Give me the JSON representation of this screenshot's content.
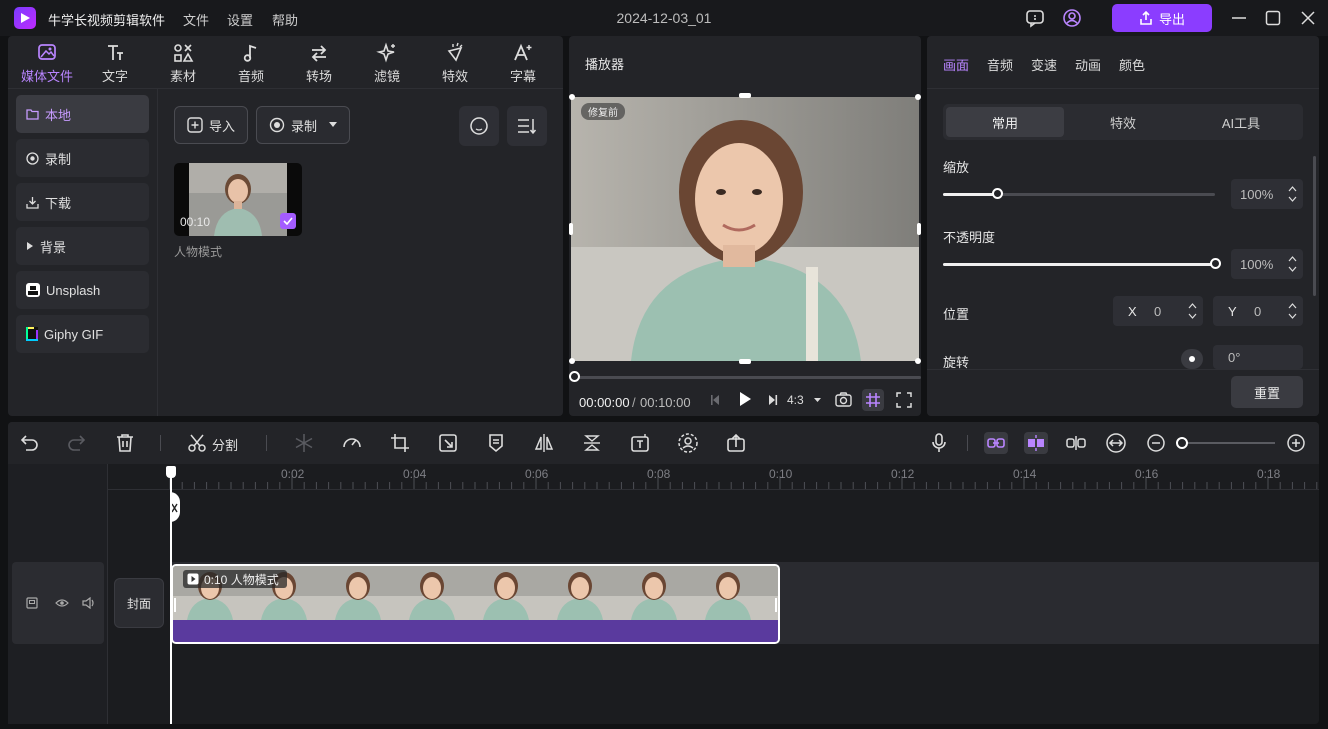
{
  "app": {
    "title": "牛学长视频剪辑软件",
    "menu": [
      "文件",
      "设置",
      "帮助"
    ],
    "project_name": "2024-12-03_01",
    "export_label": "导出"
  },
  "media_panel": {
    "tabs": [
      {
        "label": "媒体文件",
        "icon": "media-icon"
      },
      {
        "label": "文字",
        "icon": "text-icon"
      },
      {
        "label": "素材",
        "icon": "elements-icon"
      },
      {
        "label": "音频",
        "icon": "music-icon"
      },
      {
        "label": "转场",
        "icon": "transition-icon"
      },
      {
        "label": "滤镜",
        "icon": "filter-icon"
      },
      {
        "label": "特效",
        "icon": "effects-icon"
      },
      {
        "label": "字幕",
        "icon": "subtitle-icon"
      }
    ],
    "sidebar": [
      {
        "label": "本地",
        "icon": "folder-icon"
      },
      {
        "label": "录制",
        "icon": "record-icon"
      },
      {
        "label": "下载",
        "icon": "download-icon"
      },
      {
        "label": "背景",
        "icon": "caret-right-icon"
      },
      {
        "label": "Unsplash",
        "icon": "unsplash-icon"
      },
      {
        "label": "Giphy GIF",
        "icon": "giphy-icon"
      }
    ],
    "import_label": "导入",
    "record_label": "录制",
    "clip": {
      "duration": "00:10",
      "name": "人物模式"
    }
  },
  "player": {
    "title": "播放器",
    "badge": "修复前",
    "time_current": "00:00:00",
    "time_separator": "/",
    "time_total": "00:10:00",
    "aspect_ratio": "4:3"
  },
  "properties": {
    "tabs": [
      "画面",
      "音频",
      "变速",
      "动画",
      "颜色"
    ],
    "segments": [
      "常用",
      "特效",
      "AI工具"
    ],
    "scale": {
      "label": "缩放",
      "value": "100%",
      "fraction": 0.2
    },
    "opacity": {
      "label": "不透明度",
      "value": "100%",
      "fraction": 1.0
    },
    "position": {
      "label": "位置",
      "x_label": "X",
      "x_value": "0",
      "y_label": "Y",
      "y_value": "0"
    },
    "rotation": {
      "label": "旋转",
      "value": "0°"
    },
    "reset_label": "重置"
  },
  "timeline": {
    "split_label": "分割",
    "ruler": [
      "0:02",
      "0:04",
      "0:06",
      "0:08",
      "0:10",
      "0:12",
      "0:14",
      "0:16",
      "0:18"
    ],
    "cover_label": "封面",
    "clip_label": "0:10 人物模式"
  },
  "colors": {
    "accent": "#8b3dff",
    "accent_text": "#b985ff",
    "audio_bar": "#5a3a9e"
  }
}
